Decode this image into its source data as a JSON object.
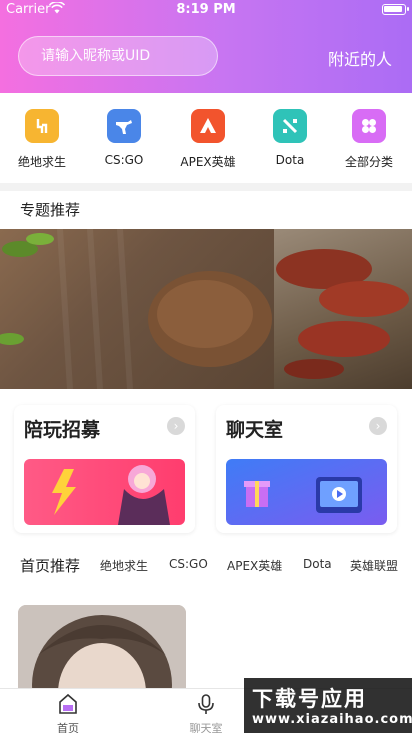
{
  "status_bar": {
    "carrier": "Carrier",
    "time": "8:19 PM"
  },
  "header": {
    "search_placeholder": "请输入昵称或UID",
    "nearby_label": "附近的人"
  },
  "categories": [
    {
      "label": "绝地求生",
      "color": "#f7b531",
      "icon": "pubg-icon"
    },
    {
      "label": "CS:GO",
      "color": "#4a86e8",
      "icon": "csgo-icon"
    },
    {
      "label": "APEX英雄",
      "color": "#f2542d",
      "icon": "apex-icon"
    },
    {
      "label": "Dota",
      "color": "#2fc3b8",
      "icon": "dota-icon"
    },
    {
      "label": "全部分类",
      "color": "#d86cf5",
      "icon": "all-categories-icon"
    }
  ],
  "featured": {
    "title": "专题推荐"
  },
  "cards": [
    {
      "title": "陪玩招募",
      "arrow": "›"
    },
    {
      "title": "聊天室",
      "arrow": "›"
    }
  ],
  "home_tabs": {
    "main": "首页推荐",
    "items": [
      "绝地求生",
      "CS:GO",
      "APEX英雄",
      "Dota",
      "英雄联盟"
    ]
  },
  "bottom_nav": [
    {
      "label": "首页",
      "icon": "home-icon",
      "active": true
    },
    {
      "label": "聊天室",
      "icon": "microphone-icon",
      "active": false
    }
  ],
  "watermark": {
    "line1": "下载号应用",
    "line2": "www.xiazaihao.com"
  },
  "colors": {
    "header_start": "#f46fe0",
    "header_end": "#ab6cf4"
  }
}
